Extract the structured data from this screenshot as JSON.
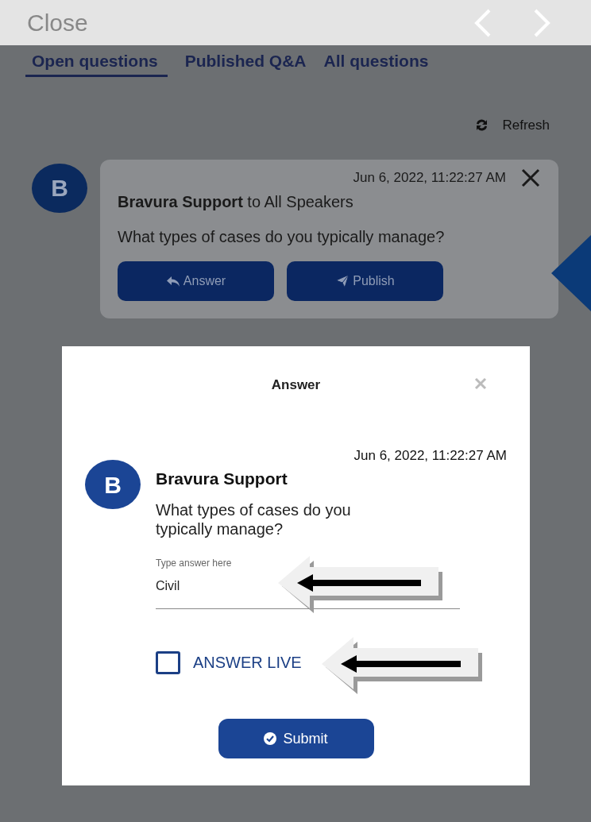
{
  "top_bar": {
    "close_label": "Close"
  },
  "tabs": [
    {
      "label": "Open questions",
      "selected": true
    },
    {
      "label": "Published Q&A",
      "selected": false
    },
    {
      "label": "All questions",
      "selected": false
    }
  ],
  "refresh": {
    "label": "Refresh"
  },
  "question_card": {
    "avatar": "B",
    "timestamp": "Jun 6, 2022, 11:22:27 AM",
    "line": "**Bravura Support** to All Speakers",
    "question": "What types of cases do you typically manage?",
    "buttons": [
      {
        "label": "Answer",
        "kind": "answer"
      },
      {
        "label": "Publish",
        "kind": "publish"
      }
    ]
  },
  "modal": {
    "title": "Answer",
    "avatar": "B",
    "timestamp": "Jun 6, 2022, 11:22:27 AM",
    "sender": "Bravura Support",
    "question": "What types of cases do you typically manage?",
    "answer_field": {
      "placeholder": "Type answer here",
      "value": "Civil"
    },
    "answer_live": {
      "label": "ANSWER LIVE",
      "checked": false
    },
    "submit_label": "Submit"
  }
}
